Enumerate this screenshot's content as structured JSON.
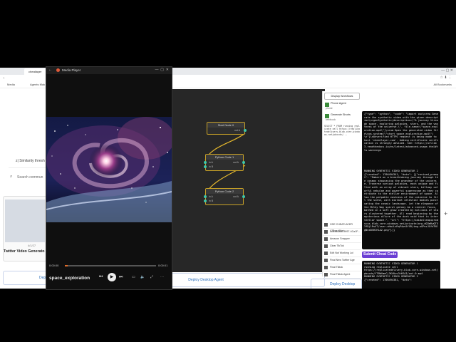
{
  "browser": {
    "tab_title": "cheatlayer",
    "bookmarks": [
      "Media",
      "Agents Mak"
    ],
    "all_bookmarks": "All Bookmarks"
  },
  "left_page": {
    "similarity_text": "z| Similarity thresh",
    "search_placeholder": "Search commun",
    "card_title": "Twitter Video Generato",
    "card_date": "4/1/27",
    "deploy_label": "Dep"
  },
  "player": {
    "app_title": "Media Player",
    "time_current": "0:00:00",
    "time_total": "0:00:01",
    "track_name": "space_exploration",
    "progress_fraction": 0.03
  },
  "canvas": {
    "nodes": [
      {
        "title": "Start Node 0",
        "out": "out A"
      },
      {
        "title": "Python Code 1",
        "in_a": "in A",
        "in_b": "in B",
        "out": "out A"
      },
      {
        "title": "Python Code 2",
        "in_a": "in A",
        "in_b": "in B",
        "out": "out A"
      }
    ],
    "deploy_label": "Deploy Desktop Agent"
  },
  "workflows": {
    "header_button": "Display Workflows",
    "top_items": [
      {
        "title": "Phone Agent",
        "sub": "phone"
      },
      {
        "title": "Generate Shorts",
        "sub": "webhook"
      }
    ],
    "log_text": "SELECT * FROM running replicate cell https://replicatedelivery.blob.core.windows.net/pbxcdn/...",
    "items": [
      "GSE CHEATLAYER 17Bsa+99c+ ...",
      "2A4446dd8 8937-4Ca1F...",
      "Amazon Snapper",
      "Clear TikTok",
      "Edit Not Working Lol",
      "Final New Twitter Age",
      "Final Tiktok",
      "Final Tiktok Agent"
    ],
    "deploy_label": "Deploy Desktop"
  },
  "right_panel": {
    "code1": "{\"type\": \"python\", \"code\": \"import osx\\nrew Generate the synthetic video with the given description\\nrgenSynthetic(description=\\\"A journey through space, exploring galaxies, stars, and the vastness of the universe.\\\", file_name=\\\"space_exploration.mp4\\\")\\nrum Open the generated video file\\nos.system(\\\"start space_exploration.mp4\\\")\\n\"}\\nUnverified HTTPS request is being made to host 'cheatlayer.com'. Adding certificate verification is strongly advised. See: https://urllib3.readthedocs.io/en/latest/advanced-usage.html#tls-warnings",
    "code2": "RUNNING SYNTHETIC VIDEO GENERATOR 2\n{\"created\": 1706494341, \"data\": [{\"revised_prompt\": \"Embark on a breathtaking journey through the cosmos showcasing the grandeur of the universe. Traverse various galaxies, each unique and filled with an array of vibrant stars, billowy colorful nebulae and powerful supernovae as they contribute to the stellar environment of space. Allow the palpable vastness of the universe to fill the scene, with distant celestial bodies punctuating the cosmic landscape. Let the elegance of the Milky Way spiral galaxy be a central focus, bathed in a soft glow created by millions of stars clustered together. All read beginning by the mysterious allure of the dark void that is interstellar space.\", \"url\": \"https://oaidalleapiprodscus.blob.core.windows.net/private/org-dQ3mRwQT53fDj1Rs4T/user-oHaiLzRqP4ws5fXR/img-oGPnzJGfdTNlgNnsBSHCR1A2.png\"}]}",
    "submit_label": "Submit Cheat Code",
    "code3": "RUNNING SYNTHETIC VIDEO GENERATOR 1\nrunning replicate cell\nhttps://replicatedelivery.blob.core.windows.net/pbxcdn/fT6WXmeCj3K4Uuv3t6SAI/out-0.mp4\nRUNNING SYNTHETIC VIDEO GENERATOR 2\n{\"created\": 1706494381, \"data\":"
  },
  "colors": {
    "node_border": "#c9a227",
    "connector": "#e6b92d",
    "port": "#3ec6a8",
    "submit_bg": "#6b3fd4",
    "wf_icon": "#3a8a3a"
  }
}
